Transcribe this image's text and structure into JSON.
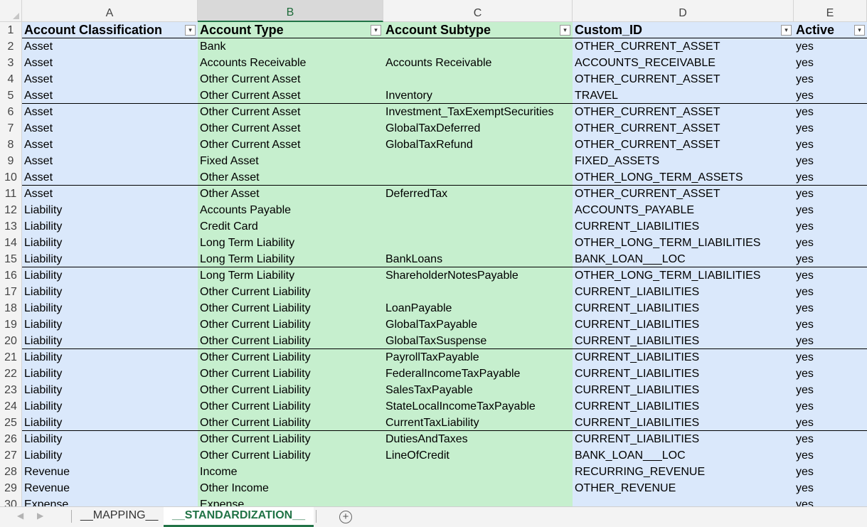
{
  "columns": [
    "A",
    "B",
    "C",
    "D",
    "E"
  ],
  "selected_column": "B",
  "header": {
    "row_num": "1",
    "a": "Account Classification",
    "b": "Account Type",
    "c": "Account Subtype",
    "d": "Custom_ID",
    "e": "Active",
    "filter_glyph": "▾"
  },
  "rows": [
    {
      "n": "2",
      "a": "Asset",
      "b": "Bank",
      "c": "",
      "d": "OTHER_CURRENT_ASSET",
      "e": "yes"
    },
    {
      "n": "3",
      "a": "Asset",
      "b": "Accounts Receivable",
      "c": "Accounts Receivable",
      "d": "ACCOUNTS_RECEIVABLE",
      "e": "yes"
    },
    {
      "n": "4",
      "a": "Asset",
      "b": "Other Current Asset",
      "c": "",
      "d": "OTHER_CURRENT_ASSET",
      "e": "yes"
    },
    {
      "n": "5",
      "a": "Asset",
      "b": "Other Current Asset",
      "c": "Inventory",
      "d": "TRAVEL",
      "e": "yes"
    },
    {
      "n": "6",
      "a": "Asset",
      "b": "Other Current Asset",
      "c": "Investment_TaxExemptSecurities",
      "d": "OTHER_CURRENT_ASSET",
      "e": "yes"
    },
    {
      "n": "7",
      "a": "Asset",
      "b": "Other Current Asset",
      "c": "GlobalTaxDeferred",
      "d": "OTHER_CURRENT_ASSET",
      "e": "yes"
    },
    {
      "n": "8",
      "a": "Asset",
      "b": "Other Current Asset",
      "c": "GlobalTaxRefund",
      "d": "OTHER_CURRENT_ASSET",
      "e": "yes"
    },
    {
      "n": "9",
      "a": "Asset",
      "b": "Fixed Asset",
      "c": "",
      "d": "FIXED_ASSETS",
      "e": "yes"
    },
    {
      "n": "10",
      "a": "Asset",
      "b": "Other Asset",
      "c": "",
      "d": "OTHER_LONG_TERM_ASSETS",
      "e": "yes"
    },
    {
      "n": "11",
      "a": "Asset",
      "b": "Other Asset",
      "c": "DeferredTax",
      "d": "OTHER_CURRENT_ASSET",
      "e": "yes"
    },
    {
      "n": "12",
      "a": "Liability",
      "b": "Accounts Payable",
      "c": "",
      "d": "ACCOUNTS_PAYABLE",
      "e": "yes"
    },
    {
      "n": "13",
      "a": "Liability",
      "b": "Credit Card",
      "c": "",
      "d": "CURRENT_LIABILITIES",
      "e": "yes"
    },
    {
      "n": "14",
      "a": "Liability",
      "b": "Long Term Liability",
      "c": "",
      "d": "OTHER_LONG_TERM_LIABILITIES",
      "e": "yes"
    },
    {
      "n": "15",
      "a": "Liability",
      "b": "Long Term Liability",
      "c": "BankLoans",
      "d": "BANK_LOAN___LOC",
      "e": "yes"
    },
    {
      "n": "16",
      "a": "Liability",
      "b": "Long Term Liability",
      "c": "ShareholderNotesPayable",
      "d": "OTHER_LONG_TERM_LIABILITIES",
      "e": "yes"
    },
    {
      "n": "17",
      "a": "Liability",
      "b": "Other Current Liability",
      "c": "",
      "d": "CURRENT_LIABILITIES",
      "e": "yes"
    },
    {
      "n": "18",
      "a": "Liability",
      "b": "Other Current Liability",
      "c": "LoanPayable",
      "d": "CURRENT_LIABILITIES",
      "e": "yes"
    },
    {
      "n": "19",
      "a": "Liability",
      "b": "Other Current Liability",
      "c": "GlobalTaxPayable",
      "d": "CURRENT_LIABILITIES",
      "e": "yes"
    },
    {
      "n": "20",
      "a": "Liability",
      "b": "Other Current Liability",
      "c": "GlobalTaxSuspense",
      "d": "CURRENT_LIABILITIES",
      "e": "yes"
    },
    {
      "n": "21",
      "a": "Liability",
      "b": "Other Current Liability",
      "c": "PayrollTaxPayable",
      "d": "CURRENT_LIABILITIES",
      "e": "yes"
    },
    {
      "n": "22",
      "a": "Liability",
      "b": "Other Current Liability",
      "c": "FederalIncomeTaxPayable",
      "d": "CURRENT_LIABILITIES",
      "e": "yes"
    },
    {
      "n": "23",
      "a": "Liability",
      "b": "Other Current Liability",
      "c": "SalesTaxPayable",
      "d": "CURRENT_LIABILITIES",
      "e": "yes"
    },
    {
      "n": "24",
      "a": "Liability",
      "b": "Other Current Liability",
      "c": "StateLocalIncomeTaxPayable",
      "d": "CURRENT_LIABILITIES",
      "e": "yes"
    },
    {
      "n": "25",
      "a": "Liability",
      "b": "Other Current Liability",
      "c": "CurrentTaxLiability",
      "d": "CURRENT_LIABILITIES",
      "e": "yes"
    },
    {
      "n": "26",
      "a": "Liability",
      "b": "Other Current Liability",
      "c": "DutiesAndTaxes",
      "d": "CURRENT_LIABILITIES",
      "e": "yes"
    },
    {
      "n": "27",
      "a": "Liability",
      "b": "Other Current Liability",
      "c": "LineOfCredit",
      "d": "BANK_LOAN___LOC",
      "e": "yes"
    },
    {
      "n": "28",
      "a": "Revenue",
      "b": "Income",
      "c": "",
      "d": "RECURRING_REVENUE",
      "e": "yes"
    },
    {
      "n": "29",
      "a": "Revenue",
      "b": "Other Income",
      "c": "",
      "d": "OTHER_REVENUE",
      "e": "yes"
    },
    {
      "n": "30",
      "a": "Expense",
      "b": "Expense",
      "c": "",
      "d": "",
      "e": "yes"
    }
  ],
  "band_rows": [
    "5",
    "10",
    "15",
    "20",
    "25"
  ],
  "tabs": [
    {
      "label": "__MAPPING__",
      "active": false
    },
    {
      "label": "__STANDARDIZATION__",
      "active": true
    }
  ],
  "nav": {
    "prev": "◀",
    "next": "▶"
  },
  "add_sheet_glyph": "+",
  "colors": {
    "blue_fill": "#dae8fb",
    "green_fill": "#c6efce",
    "excel_green": "#217346"
  }
}
